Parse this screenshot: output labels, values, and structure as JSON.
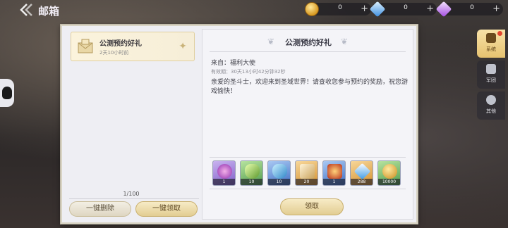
{
  "header": {
    "back_icon": "back-arrow-icon",
    "title": "邮箱"
  },
  "currencies": [
    {
      "icon": "gold-coin-icon",
      "value": "0",
      "plus": "+"
    },
    {
      "icon": "blue-diamond-icon",
      "value": "0",
      "plus": "+"
    },
    {
      "icon": "purple-diamond-icon",
      "value": "0",
      "plus": "+"
    }
  ],
  "mail_list": {
    "items": [
      {
        "title": "公测预约好礼",
        "time": "2天10小时前",
        "icon": "gift-envelope-icon"
      }
    ],
    "page_count": "1/100",
    "delete_all_label": "一键删除",
    "claim_all_label": "一键领取"
  },
  "mail_detail": {
    "title": "公测预约好礼",
    "from": "来自：福利大使",
    "expire": "有效期：30天13小时42分钟32秒",
    "body": "亲爱的圣斗士，欢迎来到圣域世界！请查收您参与预约的奖励，祝您游戏愉快！",
    "attachments": [
      {
        "icon": "purple-orb-icon",
        "quality": "purple",
        "qty": "1"
      },
      {
        "icon": "green-potion-icon",
        "quality": "green",
        "qty": "10"
      },
      {
        "icon": "blue-potion-icon",
        "quality": "blue",
        "qty": "10"
      },
      {
        "icon": "scroll-book-icon",
        "quality": "orange",
        "qty": "20"
      },
      {
        "icon": "red-box-icon",
        "quality": "blue",
        "qty": "1"
      },
      {
        "icon": "blue-diamond-icon",
        "quality": "orange",
        "qty": "288"
      },
      {
        "icon": "gold-coin-icon",
        "quality": "green",
        "qty": "10000"
      }
    ],
    "claim_label": "领取"
  },
  "side_tabs": [
    {
      "label": "系统",
      "icon": "mail-system-icon",
      "active": true
    },
    {
      "label": "军团",
      "icon": "legion-icon",
      "active": false
    },
    {
      "label": "其他",
      "icon": "other-icon",
      "active": false
    }
  ]
}
